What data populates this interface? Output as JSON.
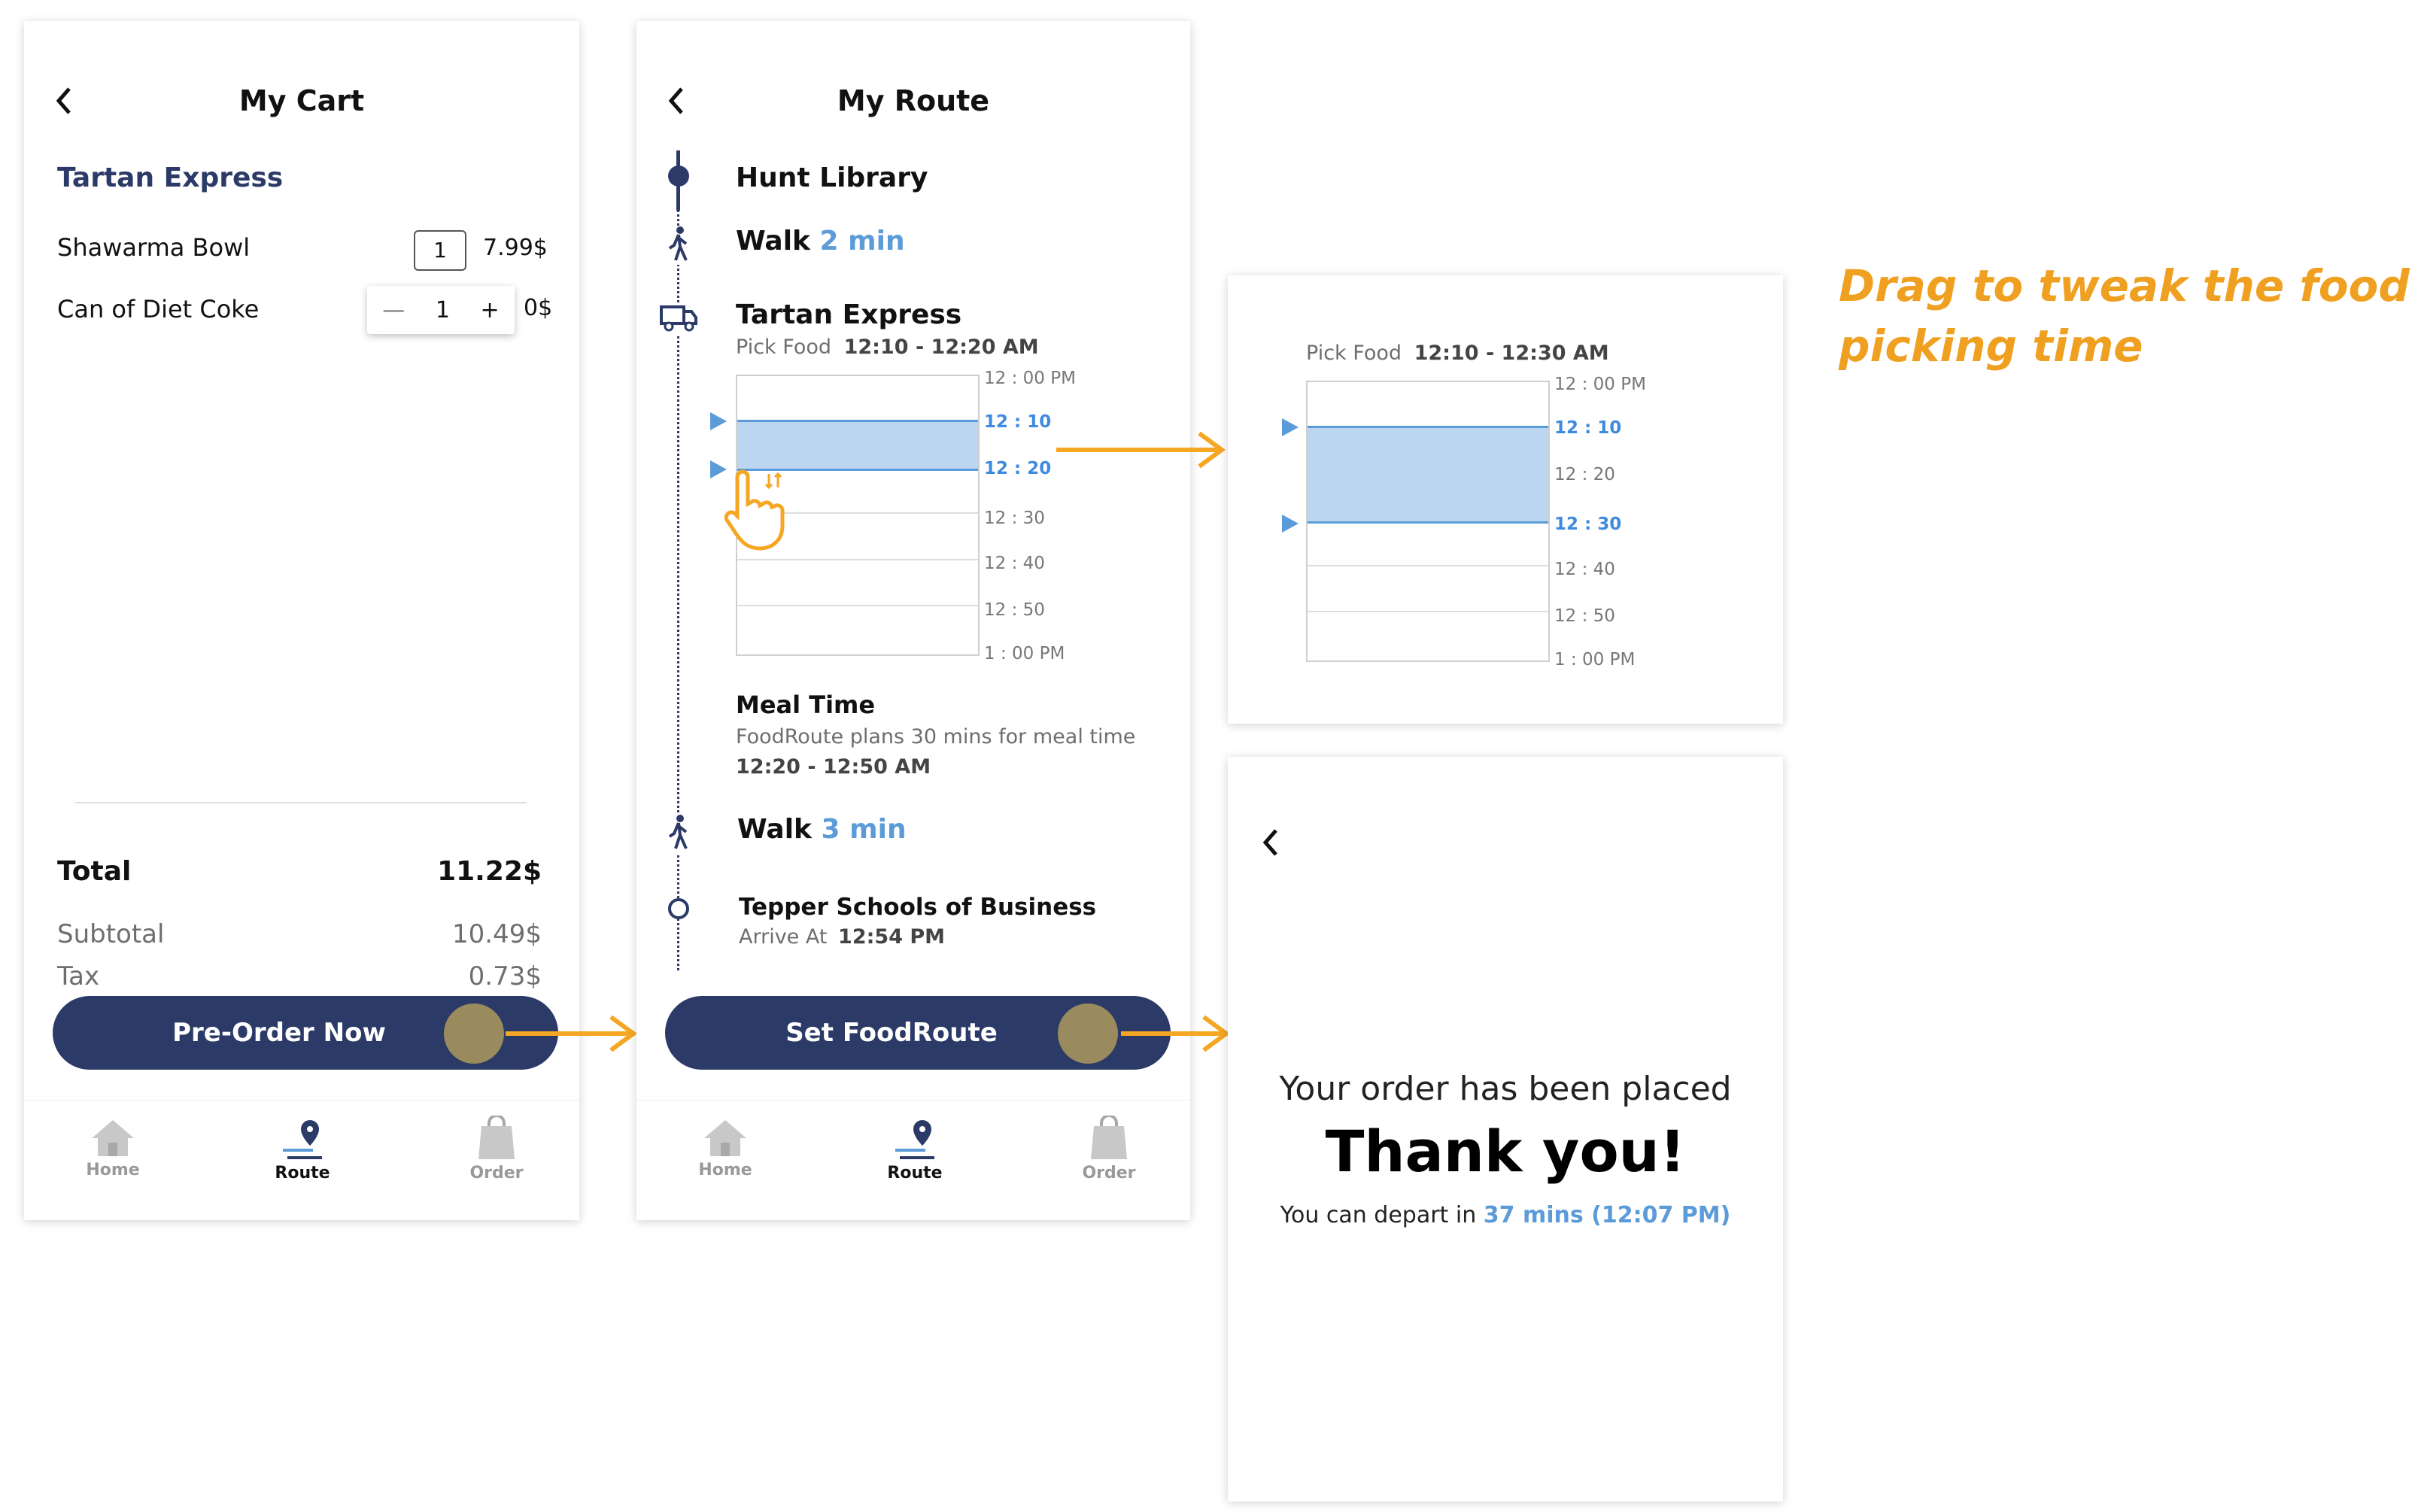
{
  "cart": {
    "title": "My Cart",
    "store": "Tartan Express",
    "items": [
      {
        "name": "Shawarma Bowl",
        "qty": "1",
        "price": "7.99$"
      },
      {
        "name": "Can of Diet Coke",
        "qty": "1",
        "price": "0$"
      }
    ],
    "stepper_minus": "—",
    "stepper_plus": "+",
    "total_label": "Total",
    "total_value": "11.22$",
    "subtotal_label": "Subtotal",
    "subtotal_value": "10.49$",
    "tax_label": "Tax",
    "tax_value": "0.73$",
    "button": "Pre-Order Now"
  },
  "route": {
    "title": "My Route",
    "start": "Hunt Library",
    "walk1_label": "Walk",
    "walk1_time": "2 min",
    "stop_name": "Tartan Express",
    "pick_label": "Pick Food",
    "pick_time": "12:10 - 12:20 AM",
    "ticks": [
      "12 : 00 PM",
      "12 : 10",
      "12 : 20",
      "12 : 30",
      "12 : 40",
      "12 : 50",
      "1 : 00 PM"
    ],
    "meal_title": "Meal Time",
    "meal_desc": "FoodRoute plans 30 mins for meal time",
    "meal_time": "12:20 - 12:50 AM",
    "walk2_label": "Walk",
    "walk2_time": "3 min",
    "dest": "Tepper Schools of Business",
    "arrive_label": "Arrive At",
    "arrive_time": "12:54 PM",
    "button": "Set FoodRoute"
  },
  "tweak": {
    "pick_label": "Pick Food",
    "pick_time": "12:10 - 12:30 AM",
    "ticks": [
      "12 : 00 PM",
      "12 : 10",
      "12 : 20",
      "12 : 30",
      "12 : 40",
      "12 : 50",
      "1 : 00 PM"
    ]
  },
  "annotation": {
    "line1": "Drag to tweak the food",
    "line2": "picking time",
    "color": "#f0a020"
  },
  "confirm": {
    "placed": "Your order has been placed",
    "thanks": "Thank you!",
    "depart_prefix": "You can depart in",
    "depart_value": "37 mins (12:07 PM)"
  },
  "nav": {
    "home": "Home",
    "route": "Route",
    "order": "Order"
  },
  "colors": {
    "navy": "#2b3a67",
    "accent_blue": "#5b9bd8",
    "knob": "#998b5e",
    "arrow": "#f5a623"
  }
}
